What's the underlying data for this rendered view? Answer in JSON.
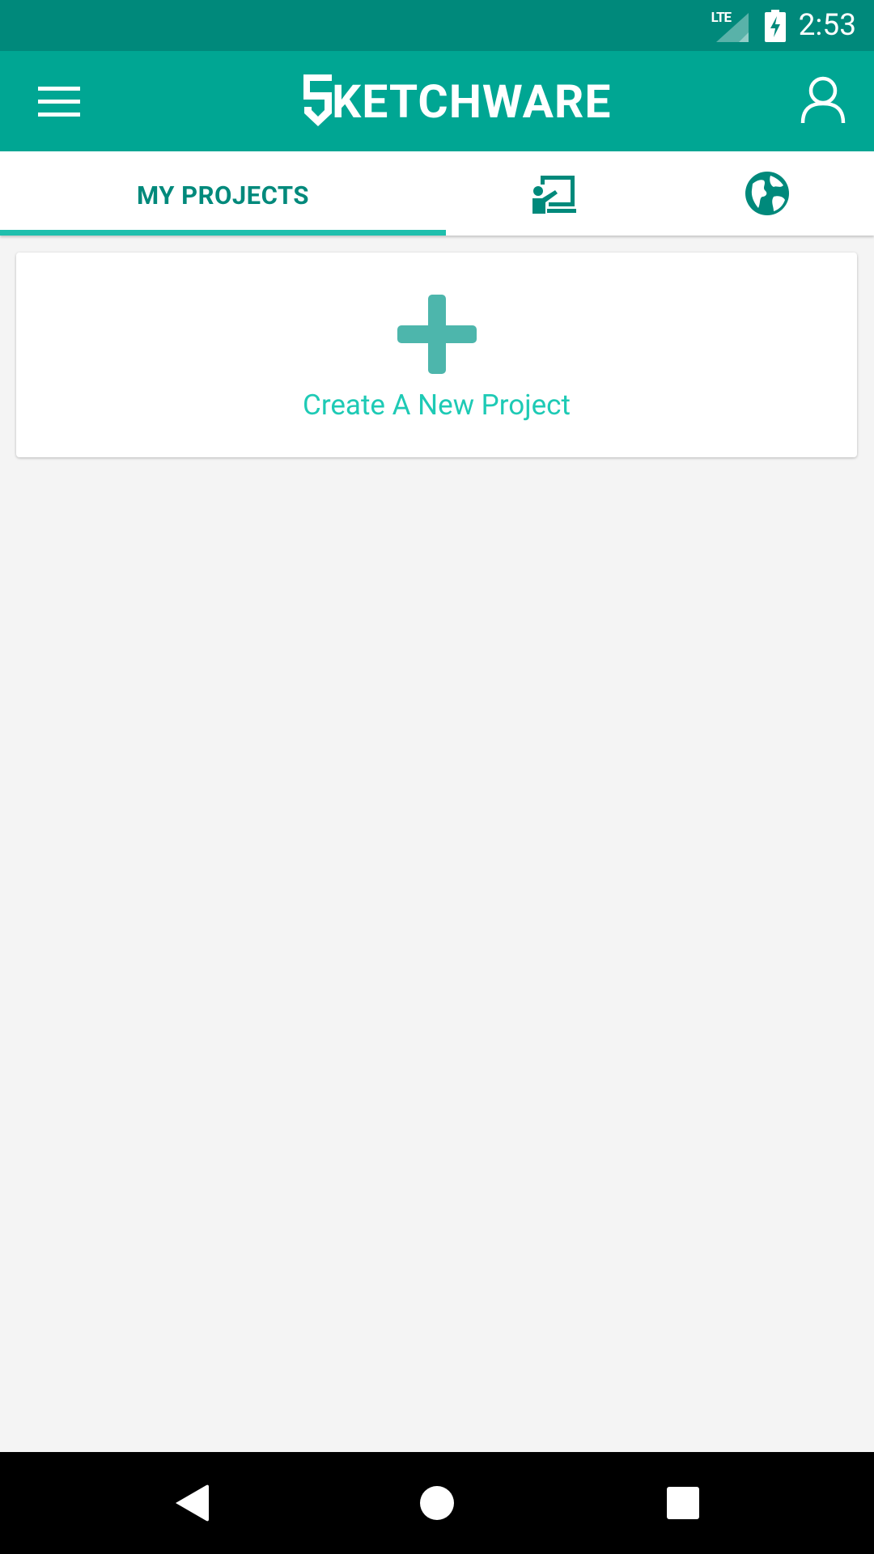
{
  "status_bar": {
    "network": "LTE",
    "time": "2:53"
  },
  "app_bar": {
    "logo_text": "KETCHWARE"
  },
  "tabs": [
    {
      "label": "MY PROJECTS",
      "selected": true
    },
    {
      "icon": "tutorial-icon",
      "selected": false
    },
    {
      "icon": "globe-icon",
      "selected": false
    }
  ],
  "create_card": {
    "label": "Create A New Project",
    "icon": "plus-icon"
  },
  "colors": {
    "status_bar": "#00897b",
    "app_bar": "#00a693",
    "accent": "#1fbfad",
    "tab_text": "#00897b",
    "plus": "#4db6ac",
    "create_text": "#1ecab5",
    "background": "#f4f4f4"
  },
  "nav_bar": {
    "buttons": [
      "back-icon",
      "home-icon",
      "recents-icon"
    ]
  }
}
